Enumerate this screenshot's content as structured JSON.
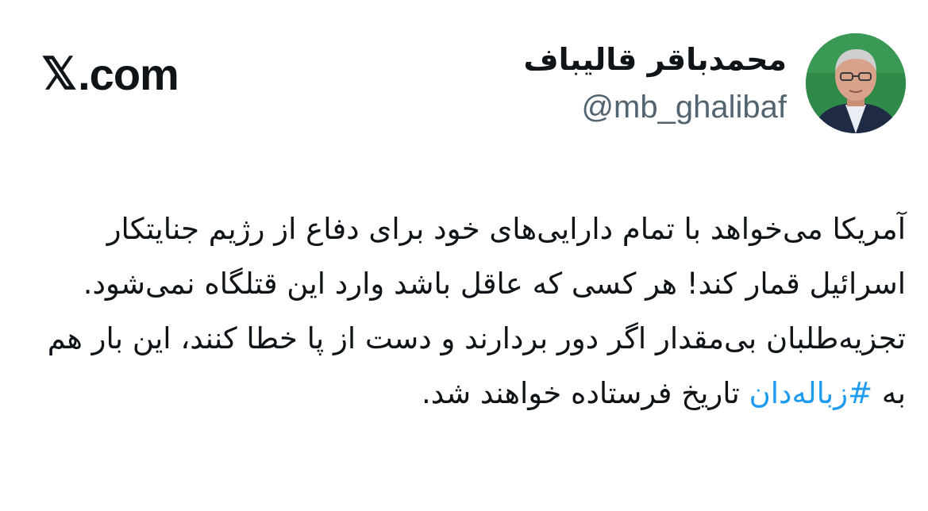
{
  "brand": {
    "x_glyph": "𝕏",
    "domain_text": ".com"
  },
  "author": {
    "display_name": "محمدباقر قالیباف",
    "handle": "@mb_ghalibaf",
    "avatar_icon": "profile-photo-avatar"
  },
  "tweet": {
    "paragraph1": "آمریکا می‌خواهد با تمام دارایی‌های خود برای دفاع از رژیم جنایتکار اسرائیل قمار کند! هر کسی که عاقل باشد وارد این قتلگاه نمی‌شود.",
    "paragraph2_before": "تجزیه‌طلبان بی‌مقدار اگر دور بردارند و دست از پا خطا کنند، این بار هم به ",
    "hashtag": "#زباله‌دان",
    "paragraph2_after": " تاریخ فرستاده خواهند شد."
  },
  "colors": {
    "text": "#0f1419",
    "secondary": "#536471",
    "link": "#1d9bf0",
    "avatar_bg": "#2f8a4a"
  }
}
